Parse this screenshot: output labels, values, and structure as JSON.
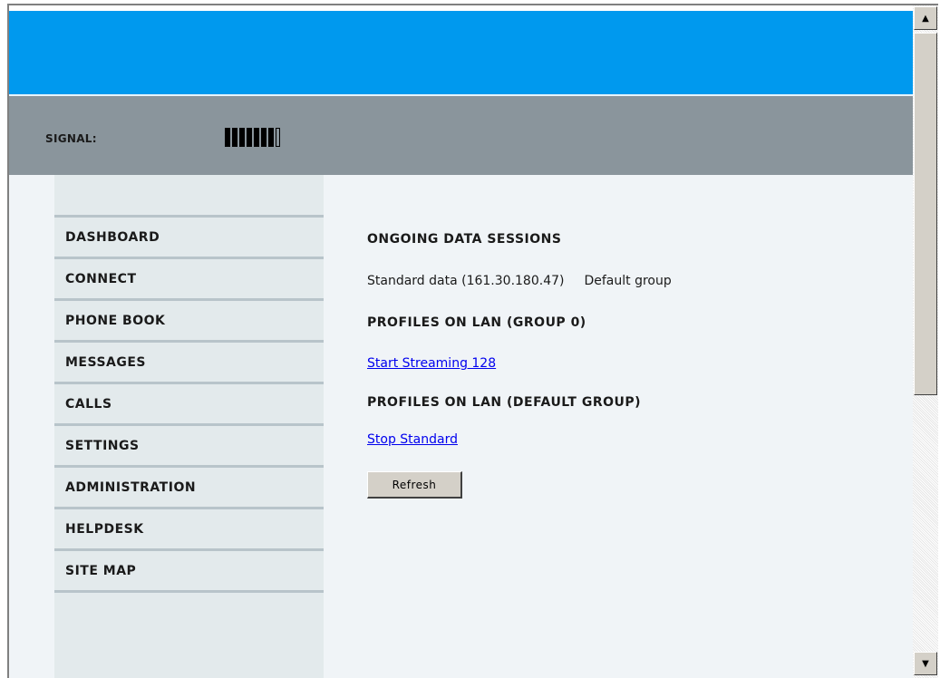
{
  "status": {
    "signal_label": "SIGNAL:",
    "signal_level": {
      "filled": 7,
      "total": 8
    }
  },
  "sidebar": {
    "items": [
      {
        "label": "DASHBOARD"
      },
      {
        "label": "CONNECT"
      },
      {
        "label": "PHONE BOOK"
      },
      {
        "label": "MESSAGES"
      },
      {
        "label": "CALLS"
      },
      {
        "label": "SETTINGS"
      },
      {
        "label": "ADMINISTRATION"
      },
      {
        "label": "HELPDESK"
      },
      {
        "label": "SITE MAP"
      }
    ]
  },
  "main": {
    "sessions_heading": "ONGOING DATA SESSIONS",
    "session": {
      "name": "Standard data (161.30.180.47)",
      "group": "Default group"
    },
    "group0_heading": "PROFILES ON LAN (GROUP 0)",
    "group0_link": "Start Streaming 128",
    "default_group_heading": "PROFILES ON LAN (DEFAULT GROUP)",
    "default_group_link": "Stop Standard",
    "refresh_button": "Refresh"
  },
  "scrollbar": {
    "up_icon": "arrow-up-icon",
    "down_icon": "arrow-down-icon"
  },
  "colors": {
    "header_blue": "#0099ee",
    "status_gray": "#8a959c",
    "sidebar_bg": "#e3eaec",
    "page_bg": "#f0f4f7",
    "link": "#0000ee"
  }
}
